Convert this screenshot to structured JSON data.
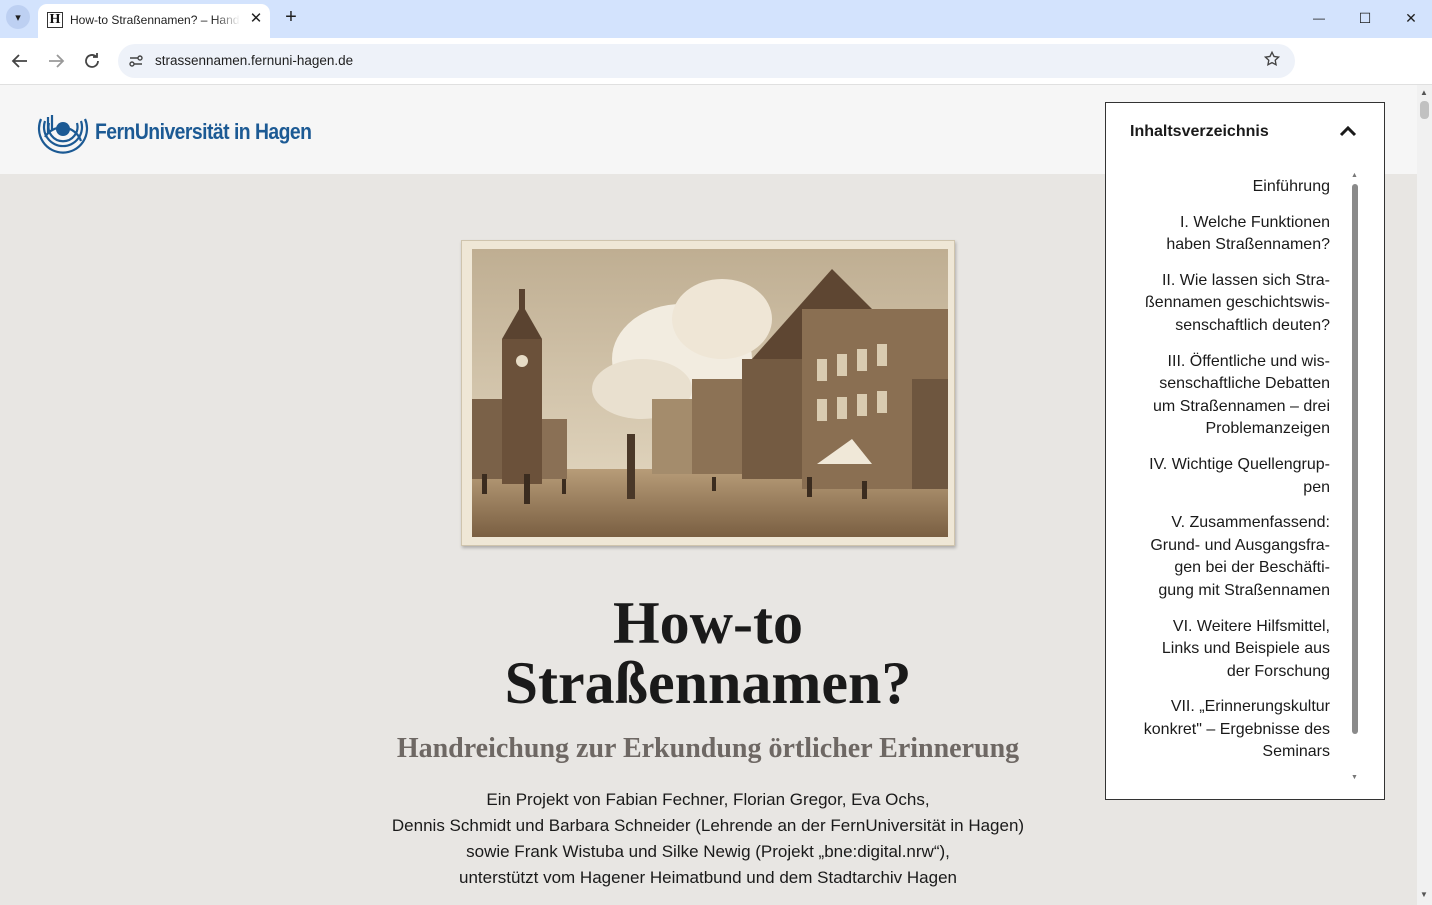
{
  "browser": {
    "tab_title": "How-to Straßennamen? – Handreichung",
    "favicon_letter": "H",
    "url": "strassennamen.fernuni-hagen.de",
    "minimize": "—",
    "maximize": "☐",
    "close": "✕",
    "new_tab": "+",
    "tab_close": "✕",
    "tab_list": "▾"
  },
  "header": {
    "logo_text": "FernUniversität in Hagen",
    "logo_color": "#1c5a94"
  },
  "hero": {
    "title_line1": "How-to",
    "title_line2": "Straßennamen?",
    "subtitle": "Handreichung zur Erkundung örtlicher Erinnerung",
    "credits": [
      "Ein Projekt von Fabian Fechner, Florian Gregor, Eva Ochs,",
      "Dennis Schmidt und Barbara Schneider (Lehrende an der FernUniversität in Hagen)",
      "sowie Frank Wistuba und Silke Newig (Projekt „bne:digital.nrw“),",
      "unterstützt vom Hagener Heimatbund und dem Stadtarchiv Hagen"
    ]
  },
  "toc": {
    "heading": "Inhaltsverzeichnis",
    "items": [
      [
        "Einführung"
      ],
      [
        "I. Welche Funktionen",
        "haben Straßennamen?"
      ],
      [
        "II. Wie lassen sich Stra-",
        "ßennamen geschichtswis-",
        "senschaftlich deuten?"
      ],
      [
        "III. Öffentliche und wis-",
        "senschaftliche Debatten",
        "um Straßennamen – drei",
        "Problemanzeigen"
      ],
      [
        "IV. Wichtige Quellengrup-",
        "pen"
      ],
      [
        "V. Zusammenfassend:",
        "Grund- und Ausgangsfra-",
        "gen bei der Beschäfti-",
        "gung mit Straßennamen"
      ],
      [
        "VI. Weitere Hilfsmittel,",
        "Links und Beispiele aus",
        "der Forschung"
      ],
      [
        "VII. „Erinnerungskultur",
        "konkret\" – Ergebnisse des",
        "Seminars"
      ]
    ]
  }
}
